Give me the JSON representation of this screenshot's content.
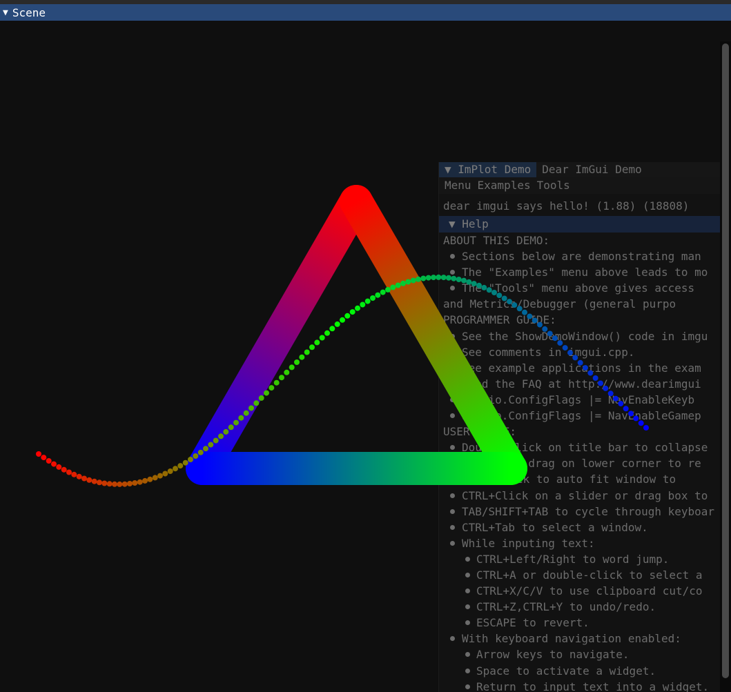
{
  "window": {
    "title": "Scene",
    "collapse_icon": "triangle-down-icon"
  },
  "demo_window": {
    "tabs": [
      "ImPlot Demo",
      "Dear ImGui Demo"
    ],
    "menu": [
      "Menu",
      "Examples",
      "Tools"
    ],
    "hello_text": "dear imgui says hello! (1.88) (18808)",
    "help_header": "Help",
    "lines": [
      {
        "level": 0,
        "text": "ABOUT THIS DEMO:"
      },
      {
        "level": 1,
        "text": "Sections below are demonstrating man"
      },
      {
        "level": 1,
        "text": "The \"Examples\" menu above leads to mo"
      },
      {
        "level": 1,
        "text": "The \"Tools\" menu above gives access"
      },
      {
        "level": 0,
        "text": "  and Metrics/Debugger (general purpo"
      },
      {
        "level": 0,
        "text": "PROGRAMMER GUIDE:"
      },
      {
        "level": 1,
        "text": "See the ShowDemoWindow() code in imgu"
      },
      {
        "level": 1,
        "text": "See comments in imgui.cpp."
      },
      {
        "level": 1,
        "text": "See example applications in the exam"
      },
      {
        "level": 1,
        "text": "Read the FAQ at http://www.dearimgui"
      },
      {
        "level": 1,
        "text": "Set io.ConfigFlags |= NavEnableKeyb"
      },
      {
        "level": 1,
        "text": "Set io.ConfigFlags |= NavEnableGamep"
      },
      {
        "level": 0,
        "text": "USER GUIDE:"
      },
      {
        "level": 1,
        "text": "Double-click on title bar to collapse"
      },
      {
        "level": 1,
        "text": "Click and drag on lower corner to re"
      },
      {
        "level": 0,
        "text": "  (double-click to auto fit window to"
      },
      {
        "level": 1,
        "text": "CTRL+Click on a slider or drag box to"
      },
      {
        "level": 1,
        "text": "TAB/SHIFT+TAB to cycle through keyboar"
      },
      {
        "level": 1,
        "text": "CTRL+Tab to select a window."
      },
      {
        "level": 1,
        "text": "While inputing text:"
      },
      {
        "level": 2,
        "text": "CTRL+Left/Right to word jump."
      },
      {
        "level": 2,
        "text": "CTRL+A or double-click to select a"
      },
      {
        "level": 2,
        "text": "CTRL+X/C/V to use clipboard cut/co"
      },
      {
        "level": 2,
        "text": "CTRL+Z,CTRL+Y to undo/redo."
      },
      {
        "level": 2,
        "text": "ESCAPE to revert."
      },
      {
        "level": 1,
        "text": "With keyboard navigation enabled:"
      },
      {
        "level": 2,
        "text": "Arrow keys to navigate."
      },
      {
        "level": 2,
        "text": "Space to activate a widget."
      },
      {
        "level": 2,
        "text": "Return to input text into a widget."
      }
    ]
  },
  "colors": {
    "titlebar": "#294a7a",
    "background": "#0f0f0f",
    "red": "#ff0000",
    "green": "#00ff00",
    "blue": "#0000ff"
  }
}
